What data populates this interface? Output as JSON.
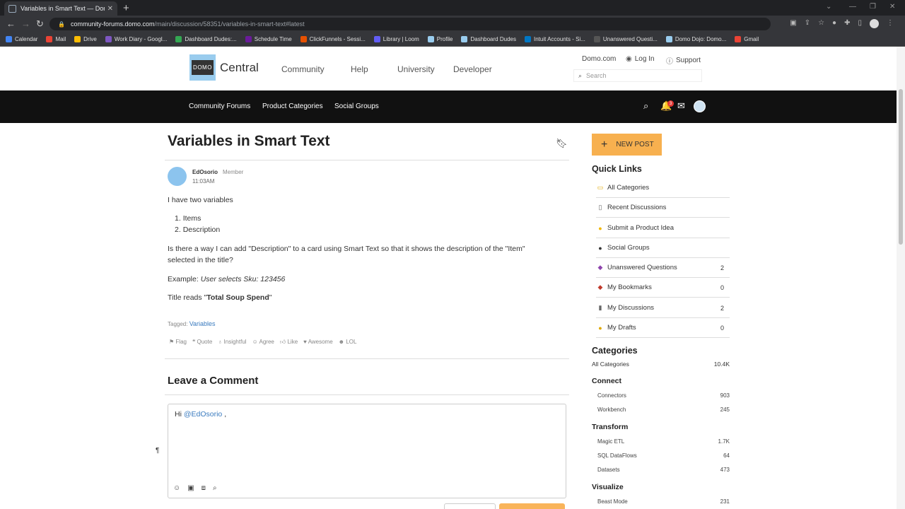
{
  "browser": {
    "tab_title": "Variables in Smart Text — Domo",
    "url_host": "community-forums.domo.com",
    "url_path": "/main/discussion/58351/variables-in-smart-text#latest",
    "bookmarks": [
      {
        "label": "Calendar",
        "color": "#4285f4"
      },
      {
        "label": "Mail",
        "color": "#ea4335"
      },
      {
        "label": "Drive",
        "color": "#fbbc04"
      },
      {
        "label": "Work Diary - Googl...",
        "color": "#7e57c2"
      },
      {
        "label": "Dashboard Dudes:...",
        "color": "#34a853"
      },
      {
        "label": "Schedule Time",
        "color": "#6a1b9a"
      },
      {
        "label": "ClickFunnels - Sessi...",
        "color": "#e65100"
      },
      {
        "label": "Library | Loom",
        "color": "#625df5"
      },
      {
        "label": "Profile",
        "color": "#99ccee"
      },
      {
        "label": "Dashboard Dudes",
        "color": "#99ccee"
      },
      {
        "label": "Intuit Accounts - Si...",
        "color": "#0077c5"
      },
      {
        "label": "Unanswered Questi...",
        "color": "#555555"
      },
      {
        "label": "Domo Dojo: Domo...",
        "color": "#99ccee"
      },
      {
        "label": "Gmail",
        "color": "#ea4335"
      }
    ]
  },
  "header": {
    "logo_text": "DOMO",
    "brand": "Central",
    "nav": [
      "Community",
      "Help",
      "University",
      "Developer"
    ],
    "domo_link": "Domo.com",
    "login": "Log In",
    "support": "Support",
    "search_placeholder": "Search"
  },
  "catbar": {
    "links": [
      "Community Forums",
      "Product Categories",
      "Social Groups"
    ],
    "notification_count": "3"
  },
  "post": {
    "title": "Variables in Smart Text",
    "author": "EdOsorio",
    "role": "Member",
    "time": "11:03AM",
    "intro": "I have two variables",
    "list": [
      "Items",
      "Description"
    ],
    "question_line1": "Is there a way I can add \"Description\" to a card using Smart Text so that it shows the description of the \"Item\"",
    "question_line2": "selected in the title?",
    "example_label": "Example: ",
    "example_value": "User selects Sku: 123456",
    "title_reads_prefix": "Title reads \"",
    "title_reads_bold": "Total Soup Spend",
    "title_reads_suffix": "\"",
    "tagged_label": "Tagged: ",
    "tag": "Variables",
    "reactions": [
      "Flag",
      "Quote",
      "Insightful",
      "Agree",
      "Like",
      "Awesome",
      "LOL"
    ]
  },
  "comment": {
    "heading": "Leave a Comment",
    "greeting": "Hi ",
    "mention": "@EdOsorio",
    "greeting_end": " ,"
  },
  "sidebar": {
    "new_post": "NEW POST",
    "quick_links_heading": "Quick Links",
    "quick_links": [
      {
        "label": "All Categories",
        "count": "",
        "icon": "folder-icon",
        "glyph": "▭",
        "color": "#e0a800"
      },
      {
        "label": "Recent Discussions",
        "count": "",
        "icon": "document-icon",
        "glyph": "▯",
        "color": "#666666"
      },
      {
        "label": "Submit a Product Idea",
        "count": "",
        "icon": "lightbulb-icon",
        "glyph": "●",
        "color": "#f2b600"
      },
      {
        "label": "Social Groups",
        "count": "",
        "icon": "group-icon",
        "glyph": "●",
        "color": "#333333"
      },
      {
        "label": "Unanswered Questions",
        "count": "2",
        "icon": "question-icon",
        "glyph": "◆",
        "color": "#8e44ad"
      },
      {
        "label": "My Bookmarks",
        "count": "0",
        "icon": "pin-icon",
        "glyph": "◆",
        "color": "#c0392b"
      },
      {
        "label": "My Discussions",
        "count": "2",
        "icon": "notebook-icon",
        "glyph": "▮",
        "color": "#666666"
      },
      {
        "label": "My Drafts",
        "count": "0",
        "icon": "draft-icon",
        "glyph": "●",
        "color": "#e0a800"
      }
    ],
    "categories_heading": "Categories",
    "all_categories": {
      "label": "All Categories",
      "count": "10.4K"
    },
    "groups": [
      {
        "name": "Connect",
        "items": [
          {
            "label": "Connectors",
            "count": "903"
          },
          {
            "label": "Workbench",
            "count": "245"
          }
        ]
      },
      {
        "name": "Transform",
        "items": [
          {
            "label": "Magic ETL",
            "count": "1.7K"
          },
          {
            "label": "SQL DataFlows",
            "count": "64"
          },
          {
            "label": "Datasets",
            "count": "473"
          }
        ]
      },
      {
        "name": "Visualize",
        "items": [
          {
            "label": "Beast Mode",
            "count": "231"
          }
        ]
      }
    ]
  }
}
